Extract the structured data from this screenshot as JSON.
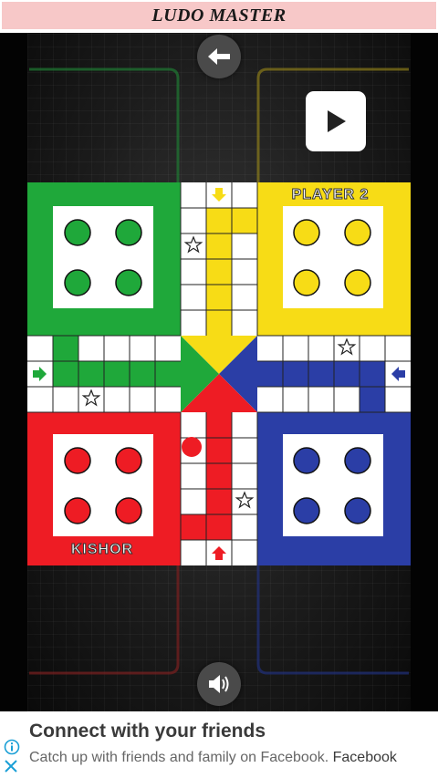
{
  "app": {
    "title": "LUDO MASTER"
  },
  "colors": {
    "green": "#1fa83a",
    "yellow": "#f7dc16",
    "red": "#ee1c24",
    "blue": "#2b3ea6",
    "header_bg": "#f7c8c8"
  },
  "game": {
    "back_icon": "arrow-left-icon",
    "play_icon": "play-icon",
    "sound_icon": "speaker-icon",
    "players": {
      "top_right": "PLAYER 2",
      "bottom_left": "KISHOR"
    },
    "pieces": [
      {
        "color": "green",
        "location": "home",
        "count": 4
      },
      {
        "color": "yellow",
        "location": "home",
        "count": 4
      },
      {
        "color": "red",
        "location": "home",
        "count": 4
      },
      {
        "color": "red",
        "location": "track",
        "count": 1
      },
      {
        "color": "blue",
        "location": "home",
        "count": 4
      }
    ]
  },
  "ad": {
    "title": "Connect with your friends",
    "subtitle": "Catch up with friends and family on Facebook.",
    "brand": "Facebook",
    "info_icon": "info-icon",
    "close_icon": "close-icon"
  }
}
